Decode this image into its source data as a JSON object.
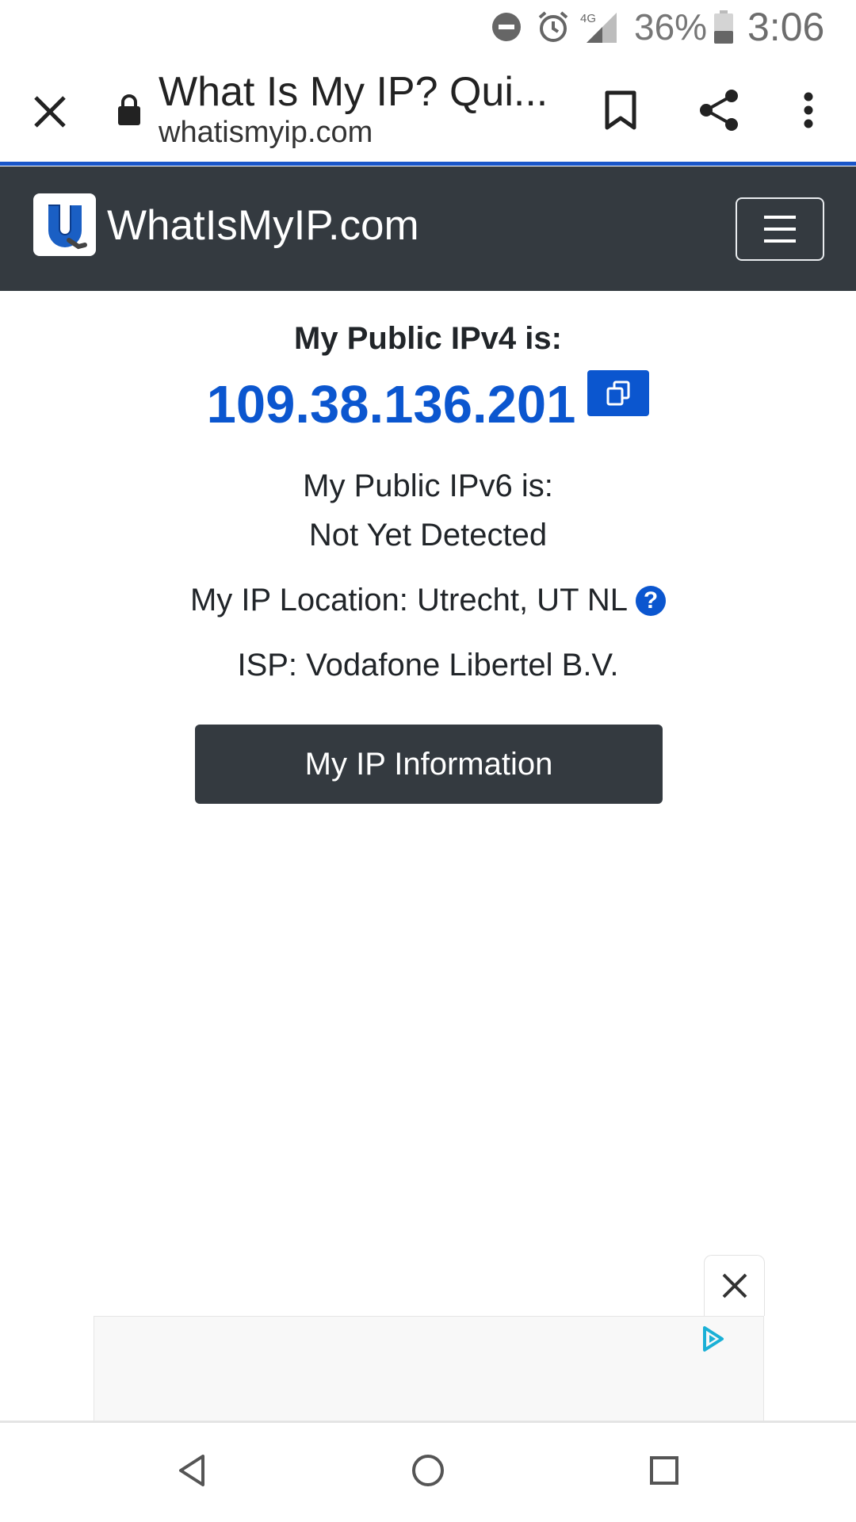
{
  "status_bar": {
    "battery_percent": "36%",
    "time": "3:06",
    "network_type": "4G",
    "icons": [
      "do-not-disturb-icon",
      "alarm-icon",
      "signal-icon",
      "battery-icon"
    ]
  },
  "browser": {
    "page_title": "What Is My IP? Qui...",
    "url": "whatismyip.com",
    "icons": [
      "close-icon",
      "lock-icon",
      "bookmark-icon",
      "share-icon",
      "more-vert-icon"
    ],
    "progress_color": "#1a56c9"
  },
  "site_nav": {
    "brand": "WhatIsMyIP.com",
    "background": "#343a40",
    "icons": [
      "site-logo",
      "hamburger-menu-icon"
    ]
  },
  "ip_info": {
    "ipv4_label": "My Public IPv4 is:",
    "ipv4_value": "109.38.136.201",
    "ipv6_label": "My Public IPv6 is:",
    "ipv6_value": "Not Yet Detected",
    "location_label": "My IP Location: Utrecht, UT NL",
    "help_glyph": "?",
    "isp_label": "ISP: Vodafone Libertel B.V.",
    "accent_color": "#0b56cf"
  },
  "actions": {
    "info_button_label": "My IP Information"
  },
  "ad": {
    "icons": [
      "close-icon",
      "adchoices-icon"
    ]
  },
  "system_nav": {
    "icons": [
      "back-icon",
      "home-icon",
      "recents-icon"
    ]
  }
}
